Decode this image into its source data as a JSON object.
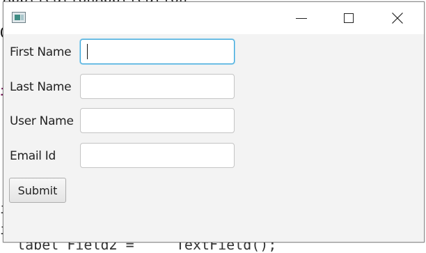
{
  "window": {
    "title": "",
    "icons": {
      "app": "app-window-icon",
      "minimize": "minimize-icon",
      "maximize": "maximize-icon",
      "close": "close-icon"
    }
  },
  "form": {
    "fields": [
      {
        "label": "First Name",
        "value": "",
        "focused": true
      },
      {
        "label": "Last Name",
        "value": ""
      },
      {
        "label": "User Name",
        "value": ""
      },
      {
        "label": "Email Id",
        "value": ""
      }
    ],
    "submit_label": "Submit"
  },
  "colors": {
    "window_bg": "#f3f3f3",
    "titlebar_bg": "#ffffff",
    "focus_border": "#3aa6d9"
  }
}
